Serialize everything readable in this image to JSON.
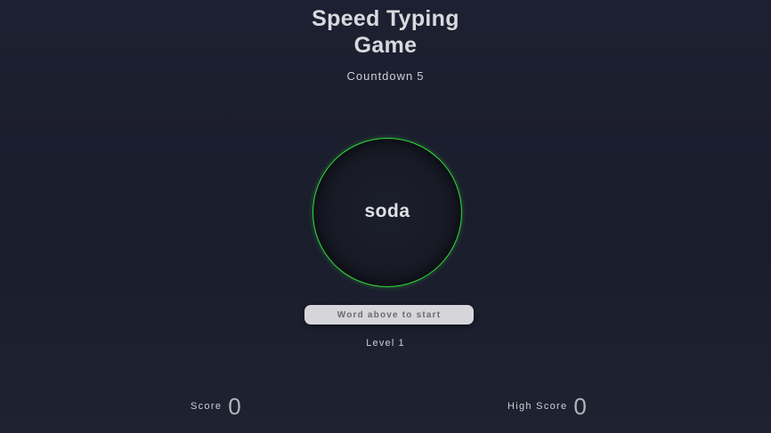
{
  "header": {
    "title_line1": "Speed Typing",
    "title_line2": "Game",
    "countdown_label": "Countdown",
    "countdown_value": "5"
  },
  "game": {
    "current_word": "soda",
    "input_placeholder": "Word above to start",
    "input_value": "",
    "level_label": "Level",
    "level_value": "1",
    "timer_ring_color": "#2fdc3a"
  },
  "stats": {
    "score_label": "Score",
    "score_value": "0",
    "high_score_label": "High Score",
    "high_score_value": "0"
  }
}
